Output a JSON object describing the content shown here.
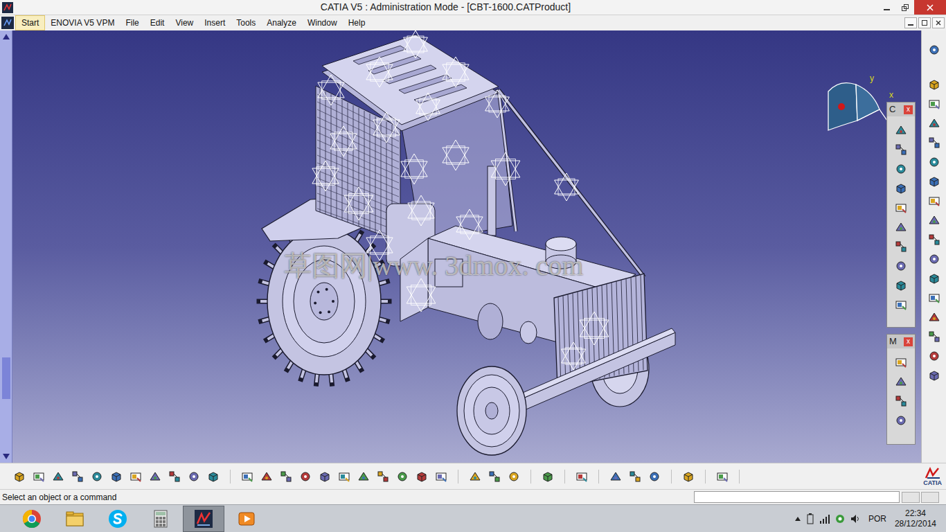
{
  "window": {
    "title": "CATIA V5 : Administration Mode - [CBT-1600.CATProduct]"
  },
  "menu": [
    {
      "label": "Start",
      "selected": true
    },
    {
      "label": "ENOVIA V5 VPM",
      "selected": false
    },
    {
      "label": "File",
      "selected": false
    },
    {
      "label": "Edit",
      "selected": false
    },
    {
      "label": "View",
      "selected": false
    },
    {
      "label": "Insert",
      "selected": false
    },
    {
      "label": "Tools",
      "selected": false
    },
    {
      "label": "Analyze",
      "selected": false
    },
    {
      "label": "Window",
      "selected": false
    },
    {
      "label": "Help",
      "selected": false
    }
  ],
  "viewport": {
    "watermark": "草图网|www. 3dmox. com",
    "compass": {
      "x_label": "x",
      "y_label": "y"
    }
  },
  "floating_toolbars": [
    {
      "title": "C",
      "close": "x"
    },
    {
      "title": "M",
      "close": "x"
    }
  ],
  "brand": {
    "logo_text": "CATIA"
  },
  "status_bar": {
    "prompt": "Select an object or a command",
    "input": ""
  },
  "taskbar": {
    "apps": [
      {
        "kind": "chrome",
        "selected": false
      },
      {
        "kind": "folder",
        "selected": false
      },
      {
        "kind": "skype",
        "selected": false
      },
      {
        "kind": "calculator",
        "selected": false
      },
      {
        "kind": "catia",
        "selected": true
      },
      {
        "kind": "media",
        "selected": false
      }
    ],
    "language": "POR",
    "time": "22:34",
    "date": "28/12/2014"
  }
}
